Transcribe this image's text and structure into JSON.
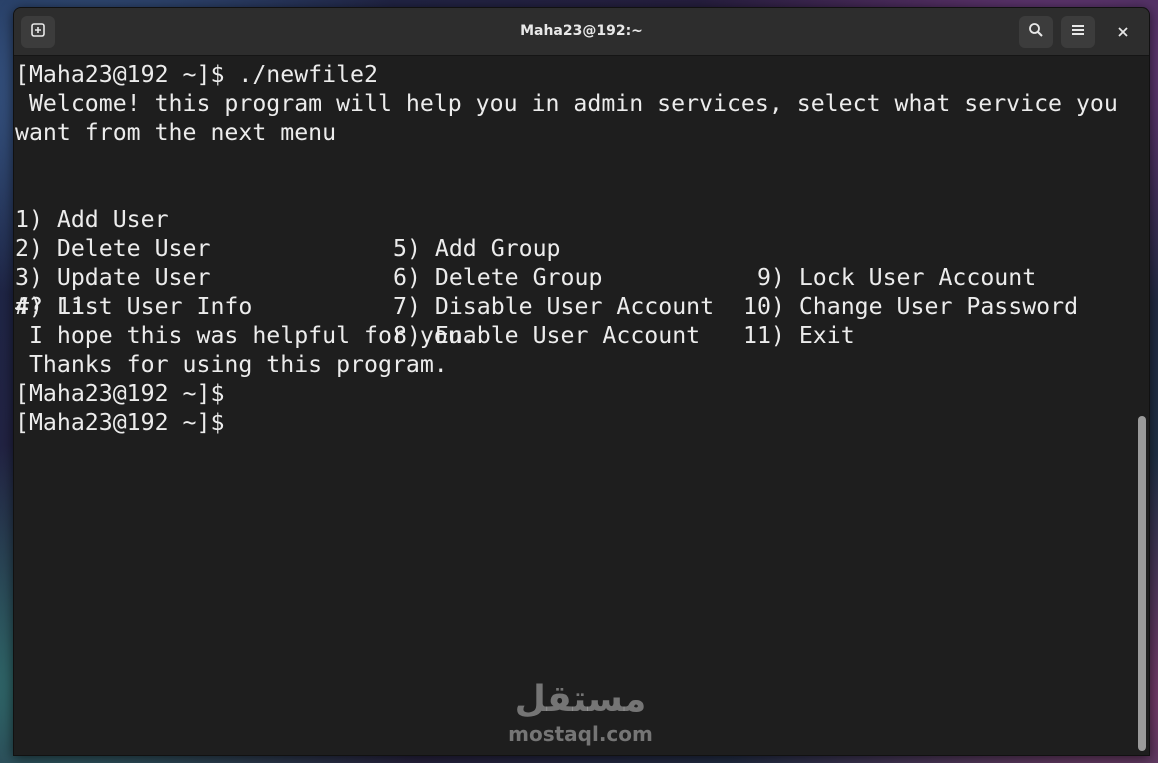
{
  "window": {
    "title": "Maha23@192:~"
  },
  "icons": {
    "new_tab": "new-tab-icon",
    "search": "search-icon",
    "menu": "hamburger-menu-icon",
    "close": "close-icon"
  },
  "terminal": {
    "prompt_cmd": "[Maha23@192 ~]$ ./newfile2",
    "welcome_1": " Welcome! this program will help you in admin services, select what service you",
    "welcome_2": "want from the next menu",
    "menu": {
      "col1": [
        "1) Add User",
        "2) Delete User",
        "3) Update User",
        "4) List User Info"
      ],
      "col2": [
        "5) Add Group",
        "6) Delete Group",
        "7) Disable User Account",
        "8) Enable User Account"
      ],
      "col3": [
        " 9) Lock User Account",
        "10) Change User Password",
        "11) Exit"
      ]
    },
    "choice": "#? 11",
    "bye_1": " I hope this was helpful for you.",
    "bye_2": " Thanks for using this program.",
    "prompt_1": "[Maha23@192 ~]$",
    "prompt_2": "[Maha23@192 ~]$"
  },
  "watermark": {
    "logo": "مستقل",
    "site": "mostaql.com"
  }
}
